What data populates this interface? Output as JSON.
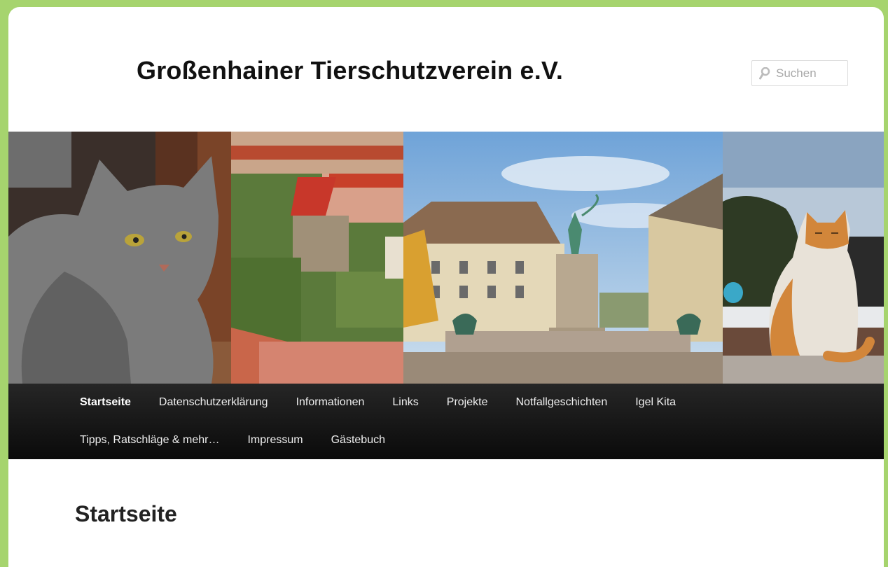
{
  "header": {
    "site_title": "Großenhainer Tierschutzverein e.V.",
    "search_placeholder": "Suchen"
  },
  "banner": {
    "panels": [
      "tabby-cat-photo",
      "town-rooftops-photo",
      "town-square-fountain-photo",
      "orange-white-cat-photo"
    ]
  },
  "nav": {
    "row1": [
      {
        "label": "Startseite",
        "current": true
      },
      {
        "label": "Datenschutzerklärung"
      },
      {
        "label": "Informationen"
      },
      {
        "label": "Links"
      },
      {
        "label": "Projekte"
      },
      {
        "label": "Notfallgeschichten"
      },
      {
        "label": "Igel Kita"
      }
    ],
    "row2": [
      {
        "label": "Tipps, Ratschläge & mehr…"
      },
      {
        "label": "Impressum"
      },
      {
        "label": "Gästebuch"
      }
    ]
  },
  "content": {
    "page_title": "Startseite"
  },
  "colors": {
    "frame": "#a6d46e",
    "nav_bg": "#1a1a1a",
    "nav_text": "#eeeeee"
  }
}
